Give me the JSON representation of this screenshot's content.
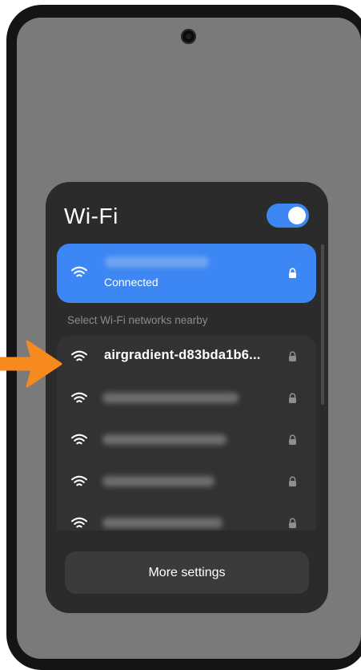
{
  "wifi_panel": {
    "title": "Wi-Fi",
    "toggle_state": "on",
    "connected_network": {
      "status": "Connected",
      "name_blurred": true
    },
    "section_label": "Select Wi-Fi networks nearby",
    "networks": [
      {
        "name": "airgradient-d83bda1b6...",
        "secured": true,
        "icon": "wifi-icon"
      },
      {
        "name": "",
        "secured": true,
        "icon": "wifi-icon",
        "blurred": true
      },
      {
        "name": "",
        "secured": true,
        "icon": "wifi-icon",
        "blurred": true
      },
      {
        "name": "",
        "secured": true,
        "icon": "wifi-icon",
        "blurred": true
      },
      {
        "name": "",
        "secured": true,
        "icon": "wifi-icon",
        "blurred": true
      }
    ],
    "more_settings_label": "More settings"
  },
  "colors": {
    "accent": "#3d87f4",
    "panel_bg": "#2b2b2b",
    "screen_bg": "#7a7a7a",
    "arrow": "#f68a1f"
  },
  "annotation": {
    "icon": "orange-arrow-icon"
  }
}
